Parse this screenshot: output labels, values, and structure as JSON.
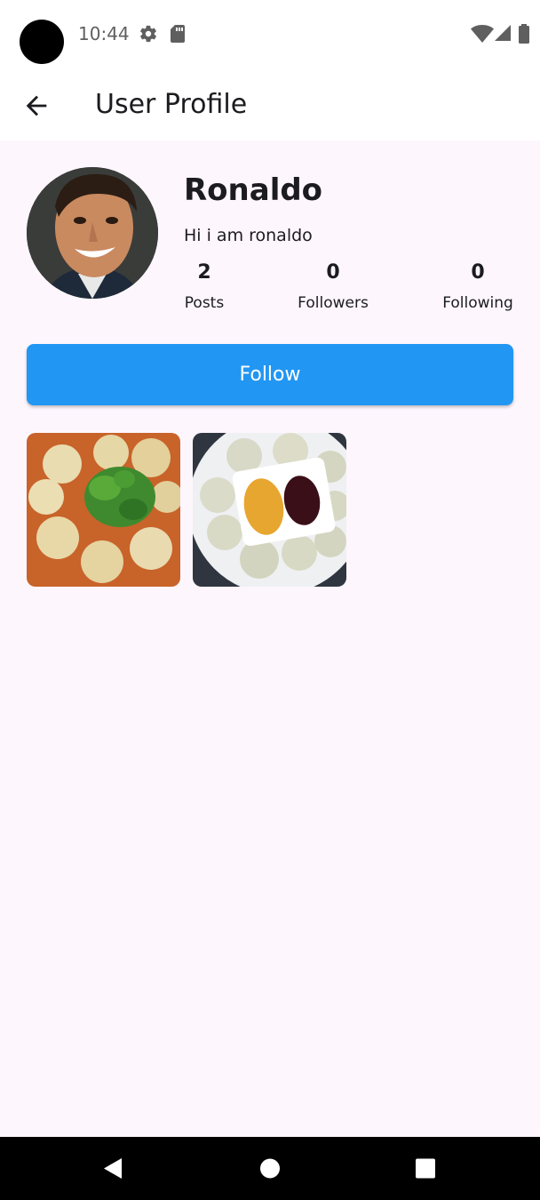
{
  "status_bar": {
    "time": "10:44",
    "icons": [
      "settings-icon",
      "sd-card-icon",
      "wifi-icon",
      "signal-icon",
      "battery-icon"
    ]
  },
  "app_bar": {
    "title": "User Profile",
    "back_icon": "arrow-back-icon"
  },
  "profile": {
    "name": "Ronaldo",
    "bio": "Hi i am ronaldo",
    "stats": [
      {
        "value": "2",
        "label": "Posts"
      },
      {
        "value": "0",
        "label": "Followers"
      },
      {
        "value": "0",
        "label": "Following"
      }
    ]
  },
  "follow_button": {
    "label": "Follow",
    "color": "#2196f3"
  },
  "posts": [
    {
      "icon": "dumplings-soup-photo"
    },
    {
      "icon": "dumplings-plate-photo"
    }
  ],
  "nav_bar": {
    "icons": [
      "back-triangle-icon",
      "home-circle-icon",
      "recents-square-icon"
    ]
  }
}
